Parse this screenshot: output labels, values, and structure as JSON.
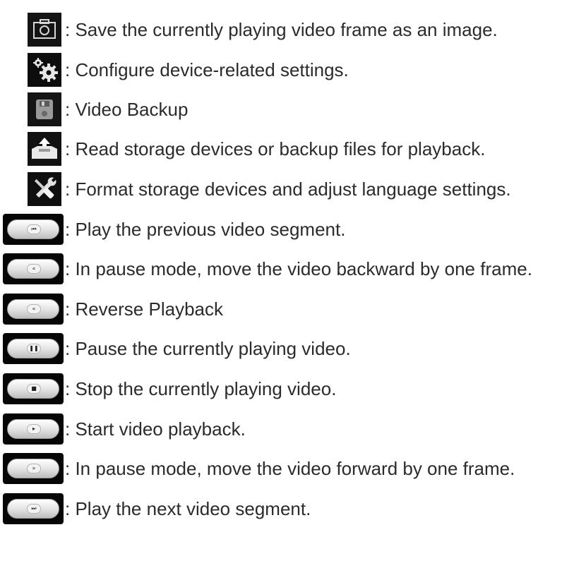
{
  "rows": [
    {
      "icon": "camera-snapshot-icon",
      "text": ": Save the currently playing video frame as an image."
    },
    {
      "icon": "gears-settings-icon",
      "text": ": Configure device-related settings."
    },
    {
      "icon": "floppy-backup-icon",
      "text": ": Video Backup"
    },
    {
      "icon": "tray-upload-icon",
      "text": ": Read storage devices or backup files for playback."
    },
    {
      "icon": "tools-wrench-screwdriver-icon",
      "text": ": Format storage devices and adjust language settings."
    },
    {
      "icon": "previous-segment-icon",
      "glyph": "⏮",
      "text": ": Play the previous video segment."
    },
    {
      "icon": "step-backward-frame-icon",
      "glyph": "«",
      "text": ": In pause mode, move the video backward by one frame."
    },
    {
      "icon": "reverse-playback-icon",
      "glyph": "«",
      "text": ": Reverse Playback"
    },
    {
      "icon": "pause-icon",
      "glyph": "❚❚",
      "text": ": Pause the currently playing video."
    },
    {
      "icon": "stop-icon",
      "glyph": "■",
      "text": ": Stop the currently playing video."
    },
    {
      "icon": "play-icon",
      "glyph": "▸",
      "text": ": Start video playback."
    },
    {
      "icon": "step-forward-frame-icon",
      "glyph": "»",
      "text": ": In pause mode, move the video forward by one frame."
    },
    {
      "icon": "next-segment-icon",
      "glyph": "⏭",
      "text": ": Play the next video segment."
    }
  ]
}
